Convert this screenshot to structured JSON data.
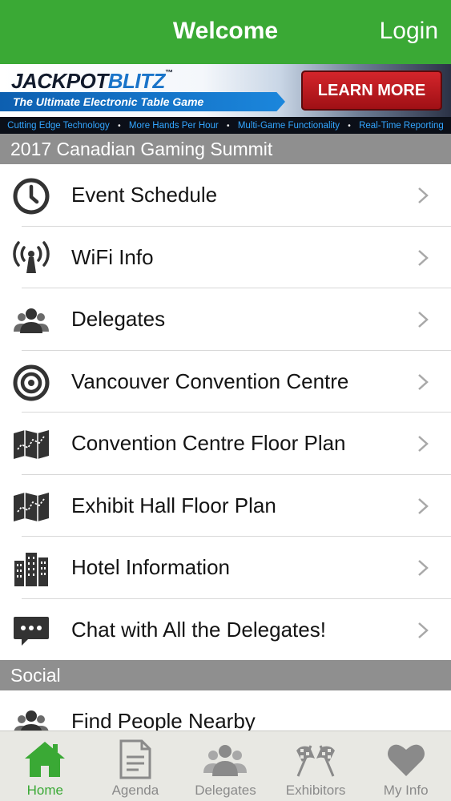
{
  "navbar": {
    "title": "Welcome",
    "login_label": "Login",
    "color": "#3aa935"
  },
  "banner": {
    "brand_part1": "JACKPOT",
    "brand_part2": "BLITZ",
    "brand_tm": "™",
    "tagline": "The Ultimate Electronic Table Game",
    "cta_label": "LEARN MORE",
    "features": [
      "Cutting Edge Technology",
      "More Hands Per Hour",
      "Multi-Game Functionality",
      "Real-Time Reporting"
    ]
  },
  "sections": {
    "summit": {
      "header": "2017 Canadian Gaming Summit",
      "items": [
        {
          "label": "Event Schedule",
          "icon": "clock-icon"
        },
        {
          "label": "WiFi Info",
          "icon": "wifi-tower-icon"
        },
        {
          "label": "Delegates",
          "icon": "people-icon"
        },
        {
          "label": "Vancouver Convention Centre",
          "icon": "target-icon"
        },
        {
          "label": "Convention Centre Floor Plan",
          "icon": "map-icon"
        },
        {
          "label": "Exhibit Hall Floor Plan",
          "icon": "map-icon"
        },
        {
          "label": "Hotel Information",
          "icon": "buildings-icon"
        },
        {
          "label": "Chat with All the Delegates!",
          "icon": "chat-bubble-icon"
        }
      ]
    },
    "social": {
      "header": "Social",
      "items": [
        {
          "label": "Find People Nearby",
          "icon": "people-icon"
        }
      ]
    }
  },
  "tabbar": {
    "active_color": "#3aa935",
    "inactive_color": "#8a8a8a",
    "tabs": [
      {
        "label": "Home",
        "icon": "home-icon",
        "active": true
      },
      {
        "label": "Agenda",
        "icon": "document-icon",
        "active": false
      },
      {
        "label": "Delegates",
        "icon": "people-icon",
        "active": false
      },
      {
        "label": "Exhibitors",
        "icon": "checkered-flags-icon",
        "active": false
      },
      {
        "label": "My Info",
        "icon": "heart-icon",
        "active": false
      }
    ]
  }
}
